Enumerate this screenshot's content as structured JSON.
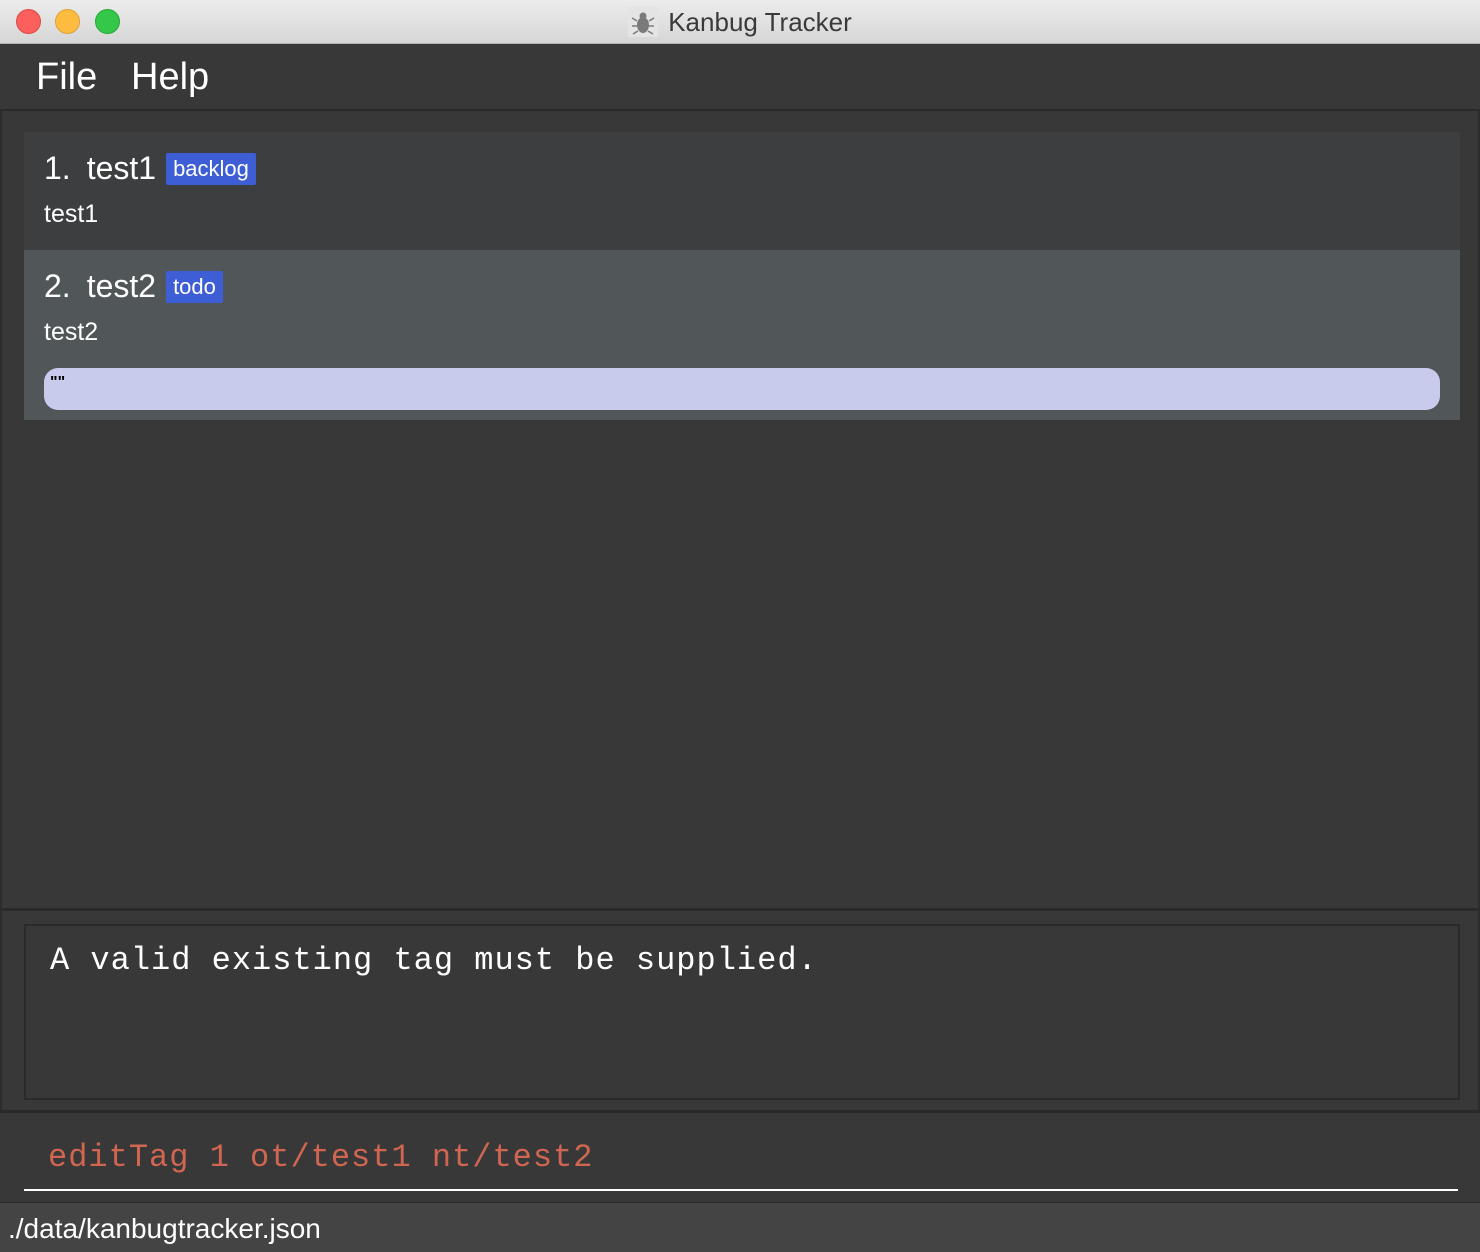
{
  "window": {
    "title": "Kanbug Tracker",
    "icon": "bug-icon"
  },
  "menu": {
    "file": "File",
    "help": "Help"
  },
  "bugs": [
    {
      "index": "1.",
      "title": "test1",
      "tag": "backlog",
      "description": "test1"
    },
    {
      "index": "2.",
      "title": "test2",
      "tag": "todo",
      "description": "test2",
      "note": "\"\""
    }
  ],
  "result": {
    "message": "A valid existing tag must be supplied."
  },
  "command": {
    "value": "editTag 1 ot/test1 nt/test2"
  },
  "status": {
    "path": "./data/kanbugtracker.json"
  },
  "colors": {
    "tag": "#3e5ed5",
    "command_error_text": "#d06651",
    "selected_card": "#515658",
    "note_pill": "#c9cbec"
  }
}
